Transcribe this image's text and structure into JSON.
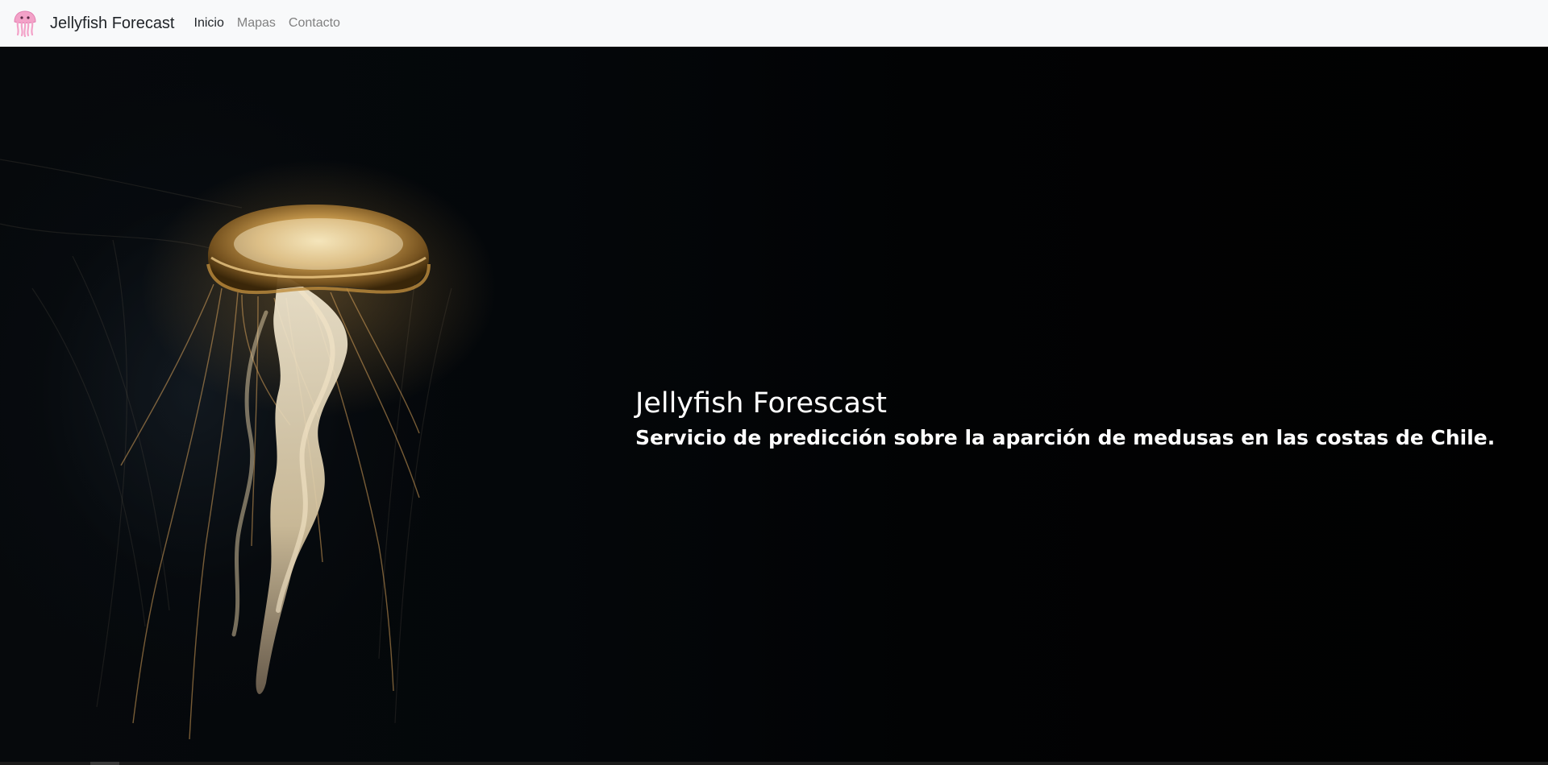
{
  "navbar": {
    "brand": {
      "logo_icon": "jellyfish-icon",
      "title": "Jellyfish Forecast"
    },
    "links": [
      {
        "label": "Inicio",
        "active": true
      },
      {
        "label": "Mapas",
        "active": false
      },
      {
        "label": "Contacto",
        "active": false
      }
    ]
  },
  "hero": {
    "image": "jellyfish-photo",
    "title": "Jellyfish Forescast",
    "subtitle": "Servicio de predicción sobre la aparción de medusas en las costas de Chile."
  },
  "colors": {
    "navbar_bg": "#f8f9fa",
    "nav_active": "#212529",
    "nav_inactive": "#808080",
    "hero_bg": "#000000",
    "logo_pink": "#f3a2c8"
  }
}
